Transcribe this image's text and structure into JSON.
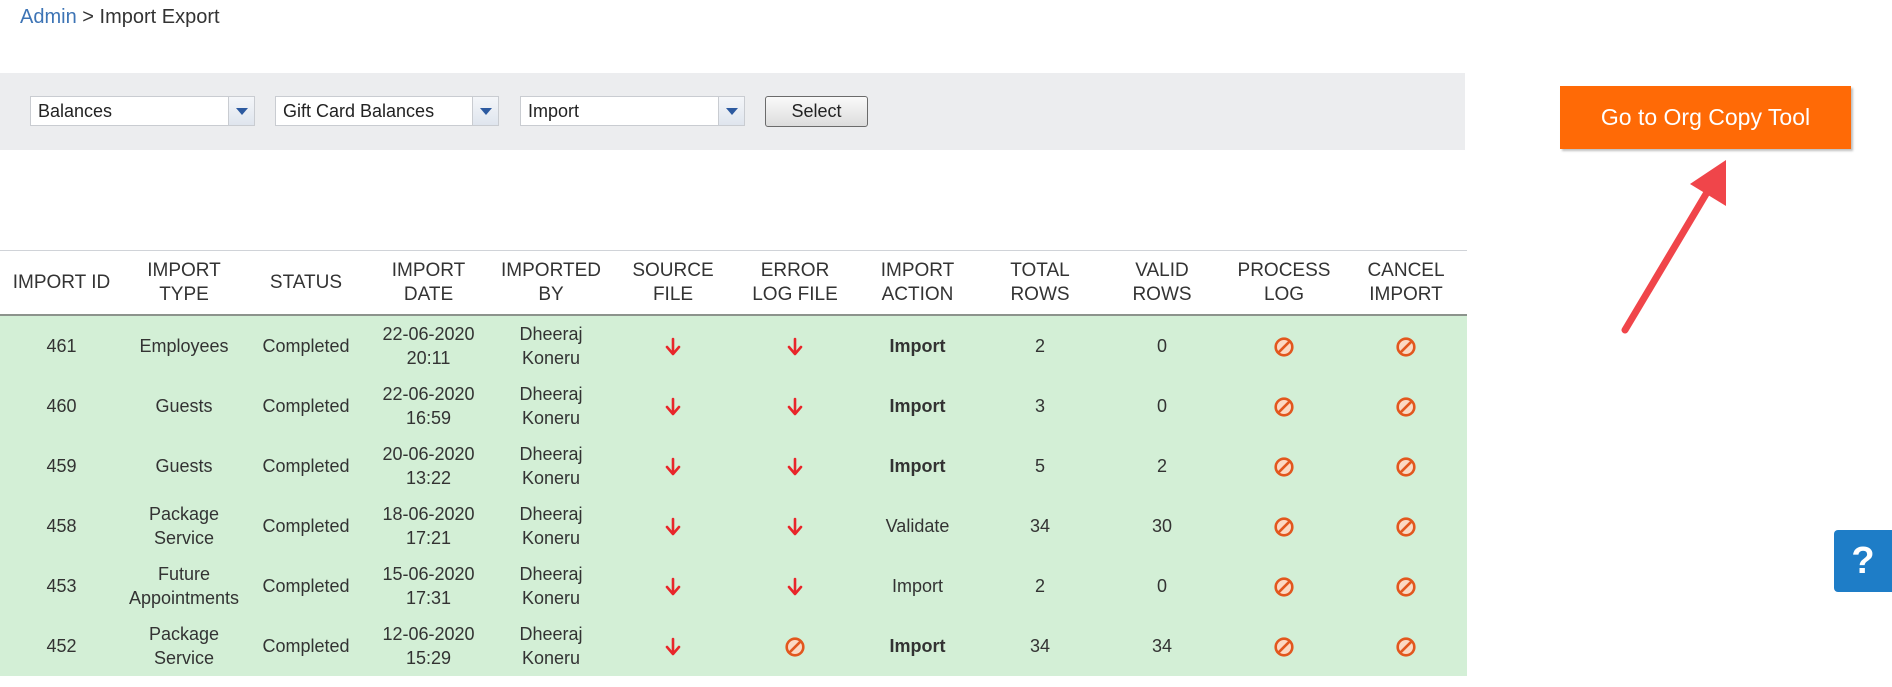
{
  "breadcrumb": {
    "root": "Admin",
    "separator": ">",
    "current": "Import Export"
  },
  "filters": {
    "category": "Balances",
    "subcategory": "Gift Card Balances",
    "action": "Import",
    "select_label": "Select"
  },
  "org_copy_button": "Go to Org Copy Tool",
  "help_label": "?",
  "colors": {
    "accent_orange": "#ff6a06",
    "row_green": "#d3efd6",
    "link_blue": "#3d74b5",
    "icon_red": "#e8262a",
    "help_blue": "#1e7dc7"
  },
  "table": {
    "headers": [
      "IMPORT ID",
      "IMPORT TYPE",
      "STATUS",
      "IMPORT DATE",
      "IMPORTED BY",
      "SOURCE FILE",
      "ERROR LOG FILE",
      "IMPORT ACTION",
      "TOTAL ROWS",
      "VALID ROWS",
      "PROCESS LOG",
      "CANCEL IMPORT"
    ],
    "rows": [
      {
        "id": "461",
        "type": "Employees",
        "status": "Completed",
        "date": "22-06-2020",
        "time": "20:11",
        "by_first": "Dheeraj",
        "by_last": "Koneru",
        "source": "download-icon",
        "errorlog": "download-icon",
        "action": "Import",
        "action_bold": true,
        "total": "2",
        "valid": "0",
        "process": "no-entry-icon",
        "cancel": "no-entry-icon"
      },
      {
        "id": "460",
        "type": "Guests",
        "status": "Completed",
        "date": "22-06-2020",
        "time": "16:59",
        "by_first": "Dheeraj",
        "by_last": "Koneru",
        "source": "download-icon",
        "errorlog": "download-icon",
        "action": "Import",
        "action_bold": true,
        "total": "3",
        "valid": "0",
        "process": "no-entry-icon",
        "cancel": "no-entry-icon"
      },
      {
        "id": "459",
        "type": "Guests",
        "status": "Completed",
        "date": "20-06-2020",
        "time": "13:22",
        "by_first": "Dheeraj",
        "by_last": "Koneru",
        "source": "download-icon",
        "errorlog": "download-icon",
        "action": "Import",
        "action_bold": true,
        "total": "5",
        "valid": "2",
        "process": "no-entry-icon",
        "cancel": "no-entry-icon"
      },
      {
        "id": "458",
        "type": "Package Service",
        "status": "Completed",
        "date": "18-06-2020",
        "time": "17:21",
        "by_first": "Dheeraj",
        "by_last": "Koneru",
        "source": "download-icon",
        "errorlog": "download-icon",
        "action": "Validate",
        "action_bold": false,
        "total": "34",
        "valid": "30",
        "process": "no-entry-icon",
        "cancel": "no-entry-icon"
      },
      {
        "id": "453",
        "type": "Future Appointments",
        "status": "Completed",
        "date": "15-06-2020",
        "time": "17:31",
        "by_first": "Dheeraj",
        "by_last": "Koneru",
        "source": "download-icon",
        "errorlog": "download-icon",
        "action": "Import",
        "action_bold": false,
        "total": "2",
        "valid": "0",
        "process": "no-entry-icon",
        "cancel": "no-entry-icon"
      },
      {
        "id": "452",
        "type": "Package Service",
        "status": "Completed",
        "date": "12-06-2020",
        "time": "15:29",
        "by_first": "Dheeraj",
        "by_last": "Koneru",
        "source": "download-icon",
        "errorlog": "no-entry-icon",
        "action": "Import",
        "action_bold": true,
        "total": "34",
        "valid": "34",
        "process": "no-entry-icon",
        "cancel": "no-entry-icon"
      }
    ]
  }
}
